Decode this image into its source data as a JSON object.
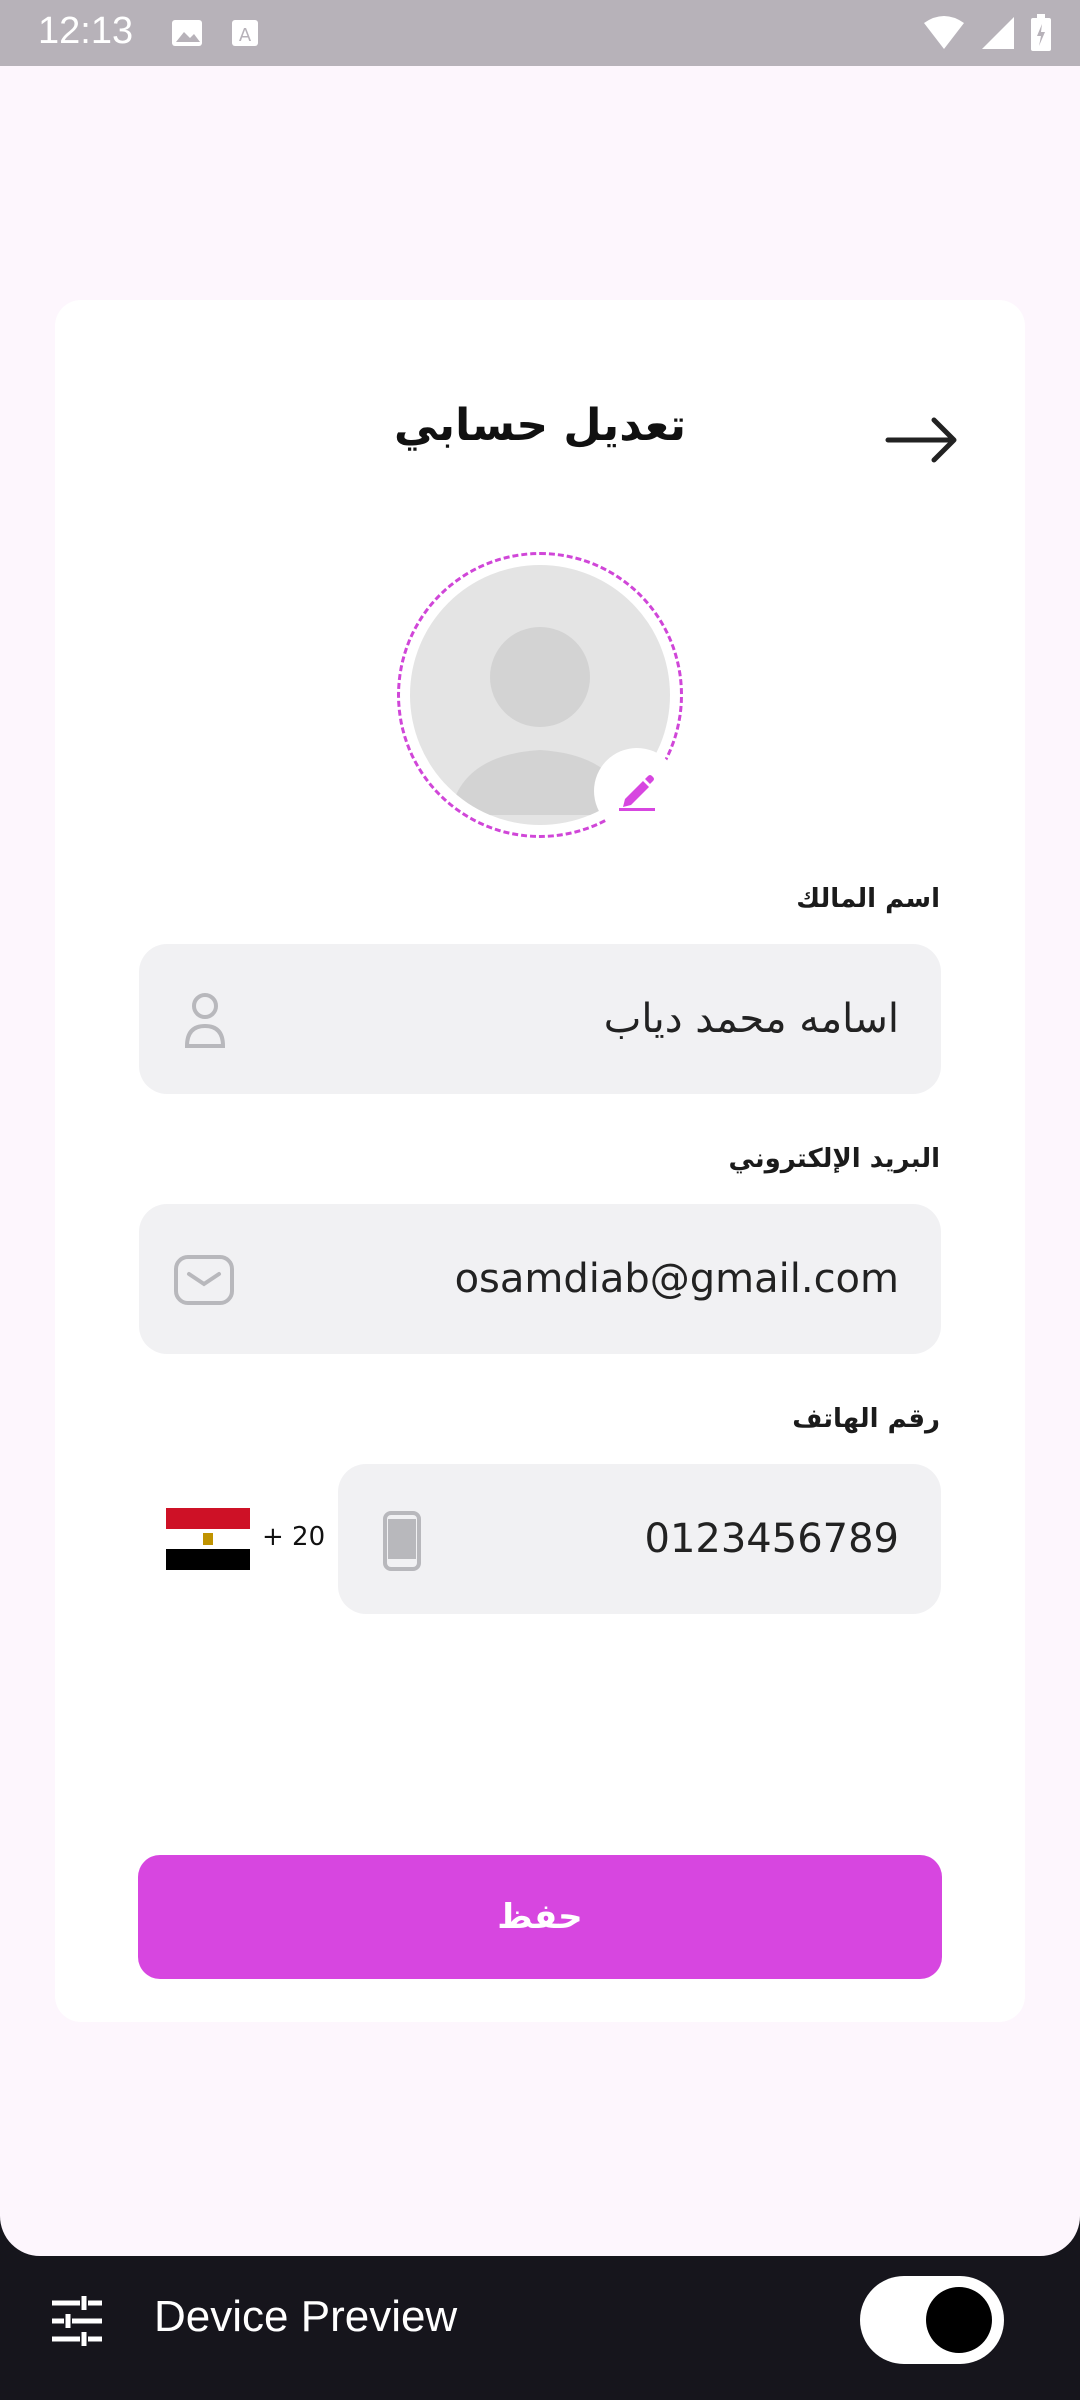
{
  "status_bar": {
    "time": "12:13"
  },
  "header": {
    "title": "تعديل حسابي"
  },
  "form": {
    "owner_name": {
      "label": "اسم المالك",
      "value": "اسامه محمد دياب"
    },
    "email": {
      "label": "البريد الإلكتروني",
      "value": "osamdiab@gmail.com"
    },
    "phone": {
      "label": "رقم الهاتف",
      "value": "0123456789",
      "dial_code": "+ 20"
    }
  },
  "actions": {
    "save_label": "حفظ"
  },
  "device_preview": {
    "label": "Device Preview",
    "enabled": true
  },
  "colors": {
    "accent": "#d746e0",
    "field_bg": "#f1f1f3",
    "page_bg": "#fdf6fd"
  }
}
